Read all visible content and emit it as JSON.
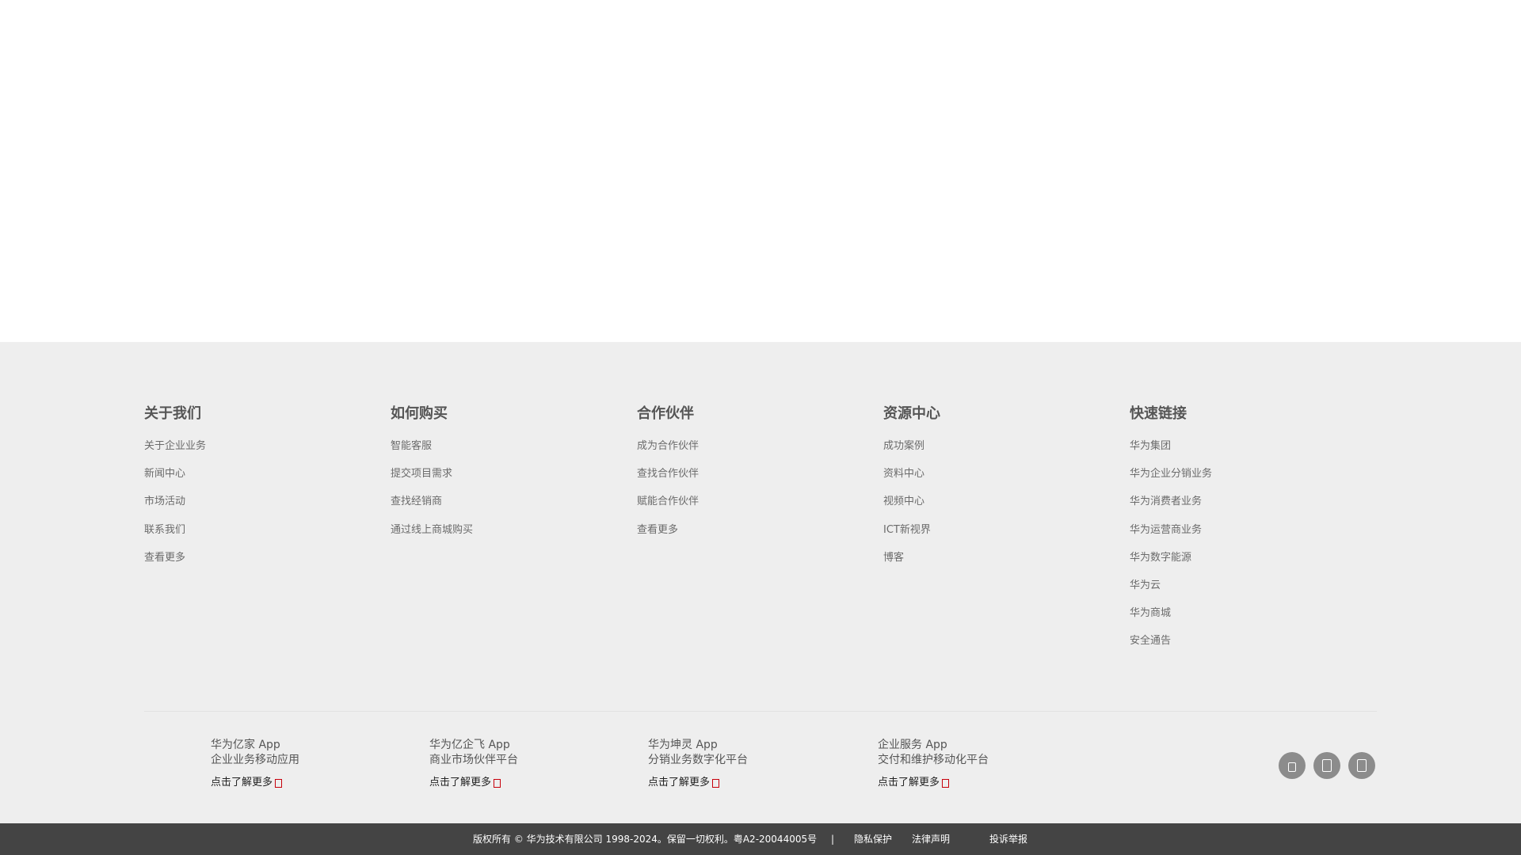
{
  "footer": {
    "columns": [
      {
        "title": "关于我们",
        "links": [
          "关于企业业务",
          "新闻中心",
          "市场活动",
          "联系我们",
          "查看更多"
        ]
      },
      {
        "title": "如何购买",
        "links": [
          "智能客服",
          "提交项目需求",
          "查找经销商",
          "通过线上商城购买"
        ]
      },
      {
        "title": "合作伙伴",
        "links": [
          "成为合作伙伴",
          "查找合作伙伴",
          "赋能合作伙伴",
          "查看更多"
        ]
      },
      {
        "title": "资源中心",
        "links": [
          "成功案例",
          "资料中心",
          "视频中心",
          "ICT新视界",
          "博客"
        ]
      },
      {
        "title": "快速链接",
        "links": [
          "华为集团",
          "华为企业分销业务",
          "华为消费者业务",
          "华为运营商业务",
          "华为数字能源",
          "华为云",
          "华为商城",
          "安全通告"
        ]
      }
    ],
    "apps": [
      {
        "name": "华为亿家 App",
        "desc": "企业业务移动应用",
        "more": "点击了解更多"
      },
      {
        "name": "华为亿企飞 App",
        "desc": "商业市场伙伴平台",
        "more": "点击了解更多"
      },
      {
        "name": "华为坤灵 App",
        "desc": "分销业务数字化平台",
        "more": "点击了解更多"
      },
      {
        "name": "企业服务 App",
        "desc": "交付和维护移动化平台",
        "more": "点击了解更多"
      }
    ],
    "socials": [
      "wechat-icon",
      "weibo-icon",
      "mobile-icon"
    ]
  },
  "bottom_bar": {
    "copyright": "版权所有 © 华为技术有限公司 1998-2024。保留一切权利。粤A2-20044005号",
    "separator": "|",
    "privacy": "隐私保护",
    "legal": "法律声明",
    "report": "投诉举报"
  },
  "colors": {
    "footer_bg": "#eeeeee",
    "bottom_bar_bg": "#444444",
    "accent": "#c7000b"
  }
}
